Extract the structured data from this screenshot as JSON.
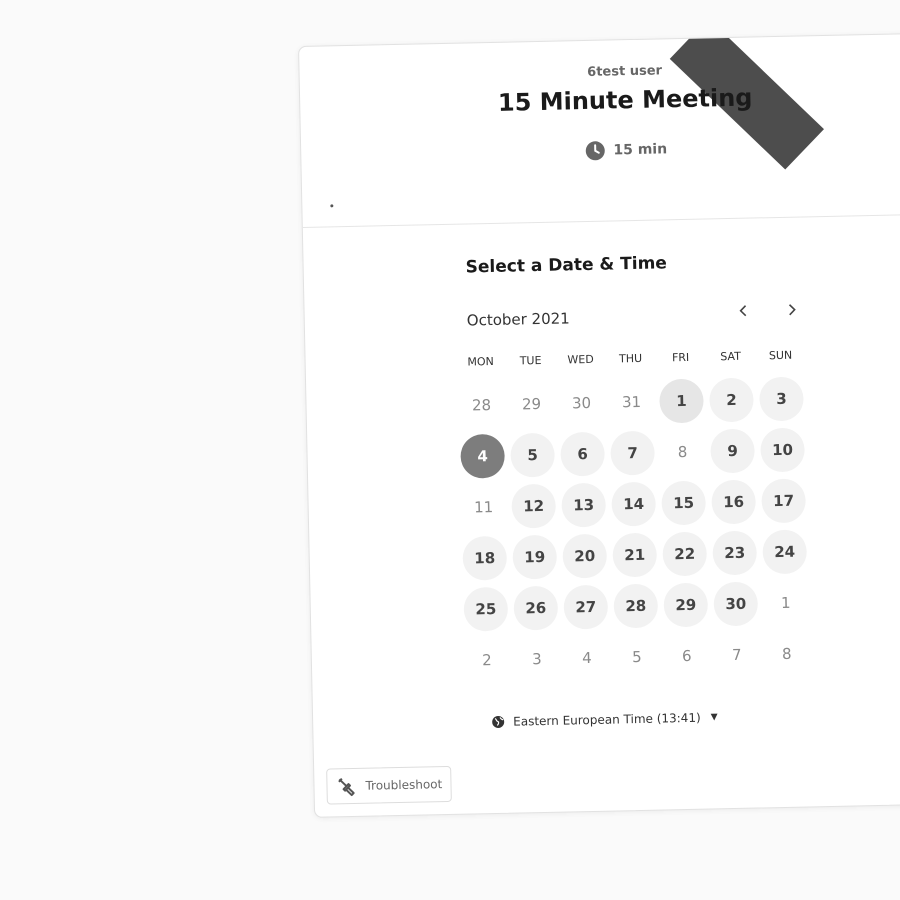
{
  "event": {
    "host": "6test user",
    "title": "15 Minute Meeting",
    "duration": "15 min"
  },
  "scheduler": {
    "section_title": "Select a Date & Time",
    "month_label": "October 2021",
    "weekdays": [
      "MON",
      "TUE",
      "WED",
      "THU",
      "FRI",
      "SAT",
      "SUN"
    ],
    "days": [
      {
        "label": "28",
        "state": "muted"
      },
      {
        "label": "29",
        "state": "muted"
      },
      {
        "label": "30",
        "state": "muted"
      },
      {
        "label": "31",
        "state": "muted"
      },
      {
        "label": "1",
        "state": "today"
      },
      {
        "label": "2",
        "state": "avail"
      },
      {
        "label": "3",
        "state": "avail"
      },
      {
        "label": "4",
        "state": "selected"
      },
      {
        "label": "5",
        "state": "avail"
      },
      {
        "label": "6",
        "state": "avail"
      },
      {
        "label": "7",
        "state": "avail"
      },
      {
        "label": "8",
        "state": "muted"
      },
      {
        "label": "9",
        "state": "avail"
      },
      {
        "label": "10",
        "state": "avail"
      },
      {
        "label": "11",
        "state": "muted"
      },
      {
        "label": "12",
        "state": "avail"
      },
      {
        "label": "13",
        "state": "avail"
      },
      {
        "label": "14",
        "state": "avail"
      },
      {
        "label": "15",
        "state": "avail"
      },
      {
        "label": "16",
        "state": "avail"
      },
      {
        "label": "17",
        "state": "avail"
      },
      {
        "label": "18",
        "state": "avail"
      },
      {
        "label": "19",
        "state": "avail"
      },
      {
        "label": "20",
        "state": "avail"
      },
      {
        "label": "21",
        "state": "avail"
      },
      {
        "label": "22",
        "state": "avail"
      },
      {
        "label": "23",
        "state": "avail"
      },
      {
        "label": "24",
        "state": "avail"
      },
      {
        "label": "25",
        "state": "avail"
      },
      {
        "label": "26",
        "state": "avail"
      },
      {
        "label": "27",
        "state": "avail"
      },
      {
        "label": "28",
        "state": "avail"
      },
      {
        "label": "29",
        "state": "avail"
      },
      {
        "label": "30",
        "state": "avail"
      },
      {
        "label": "1",
        "state": "muted"
      },
      {
        "label": "2",
        "state": "muted"
      },
      {
        "label": "3",
        "state": "muted"
      },
      {
        "label": "4",
        "state": "muted"
      },
      {
        "label": "5",
        "state": "muted"
      },
      {
        "label": "6",
        "state": "muted"
      },
      {
        "label": "7",
        "state": "muted"
      },
      {
        "label": "8",
        "state": "muted"
      }
    ],
    "timezone": "Eastern European Time (13:41)"
  },
  "footer": {
    "troubleshoot_label": "Troubleshoot"
  },
  "icons": {
    "clock": "clock-icon",
    "prev": "chevron-left-icon",
    "next": "chevron-right-icon",
    "globe": "globe-icon",
    "caret": "caret-down-icon",
    "wrench": "wrench-icon"
  },
  "colors": {
    "selected_day": "#7d7d7d",
    "available_day_bg": "#f2f2f2",
    "ribbon": "#4d4d4d"
  }
}
